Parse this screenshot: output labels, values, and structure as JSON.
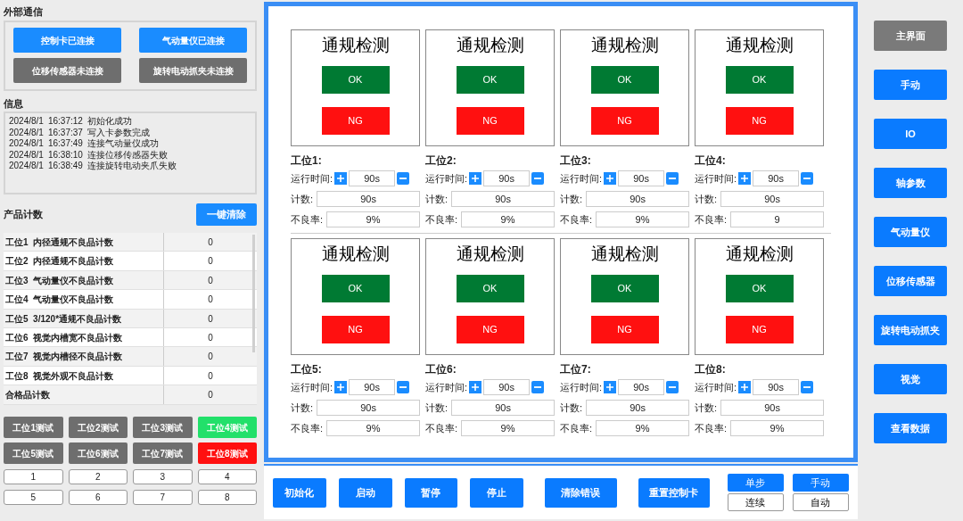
{
  "comm": {
    "title": "外部通信",
    "devices": [
      {
        "label": "控制卡已连接",
        "connected": true
      },
      {
        "label": "气动量仪已连接",
        "connected": true
      },
      {
        "label": "位移传感器未连接",
        "connected": false
      },
      {
        "label": "旋转电动抓夹未连接",
        "connected": false
      }
    ]
  },
  "info": {
    "title": "信息",
    "log": [
      {
        "date": "2024/8/1",
        "time": "16:37:12",
        "message": "初始化成功"
      },
      {
        "date": "2024/8/1",
        "time": "16:37:37",
        "message": "写入卡参数完成"
      },
      {
        "date": "2024/8/1",
        "time": "16:37:49",
        "message": "连接气动量仪成功"
      },
      {
        "date": "2024/8/1",
        "time": "16:38:10",
        "message": "连接位移传感器失败"
      },
      {
        "date": "2024/8/1",
        "time": "16:38:49",
        "message": "连接旋转电动夹爪失败"
      }
    ]
  },
  "counts": {
    "title": "产品计数",
    "clear_button": "一键清除",
    "rows": [
      {
        "label": "工位1  内径通规不良品计数",
        "value": "0"
      },
      {
        "label": "工位2  内径通规不良品计数",
        "value": "0"
      },
      {
        "label": "工位3  气动量仪不良品计数",
        "value": "0"
      },
      {
        "label": "工位4  气动量仪不良品计数",
        "value": "0"
      },
      {
        "label": "工位5  3/120*通规不良品计数",
        "value": "0"
      },
      {
        "label": "工位6  视觉内槽宽不良品计数",
        "value": "0"
      },
      {
        "label": "工位7  视觉内槽径不良品计数",
        "value": "0"
      },
      {
        "label": "工位8  视觉外观不良品计数",
        "value": "0"
      },
      {
        "label": "合格品计数",
        "value": "0"
      }
    ]
  },
  "test_buttons": [
    {
      "label": "工位1测试",
      "passed": false,
      "failed": false
    },
    {
      "label": "工位2测试",
      "passed": false,
      "failed": false
    },
    {
      "label": "工位3测试",
      "passed": false,
      "failed": false
    },
    {
      "label": "工位4测试",
      "passed": true,
      "failed": false
    },
    {
      "label": "工位5测试",
      "passed": false,
      "failed": false
    },
    {
      "label": "工位6测试",
      "passed": false,
      "failed": false
    },
    {
      "label": "工位7测试",
      "passed": false,
      "failed": false
    },
    {
      "label": "工位8测试",
      "passed": false,
      "failed": true
    }
  ],
  "number_buttons": [
    "1",
    "2",
    "3",
    "4",
    "5",
    "6",
    "7",
    "8"
  ],
  "stations": [
    {
      "title": "通规检测",
      "ok": "OK",
      "ng": "NG",
      "name": "工位1:",
      "runtime_label": "运行时间:",
      "runtime": "90s",
      "count_label": "计数:",
      "count": "90s",
      "reject_label": "不良率:",
      "reject": "9%"
    },
    {
      "title": "通规检测",
      "ok": "OK",
      "ng": "NG",
      "name": "工位2:",
      "runtime_label": "运行时间:",
      "runtime": "90s",
      "count_label": "计数:",
      "count": "90s",
      "reject_label": "不良率:",
      "reject": "9%"
    },
    {
      "title": "通规检测",
      "ok": "OK",
      "ng": "NG",
      "name": "工位3:",
      "runtime_label": "运行时间:",
      "runtime": "90s",
      "count_label": "计数:",
      "count": "90s",
      "reject_label": "不良率:",
      "reject": "9%"
    },
    {
      "title": "通规检测",
      "ok": "OK",
      "ng": "NG",
      "name": "工位4:",
      "runtime_label": "运行时间:",
      "runtime": "90s",
      "count_label": "计数:",
      "count": "90s",
      "reject_label": "不良率:",
      "reject": "9"
    },
    {
      "title": "通规检测",
      "ok": "OK",
      "ng": "NG",
      "name": "工位5:",
      "runtime_label": "运行时间:",
      "runtime": "90s",
      "count_label": "计数:",
      "count": "90s",
      "reject_label": "不良率:",
      "reject": "9%"
    },
    {
      "title": "通规检测",
      "ok": "OK",
      "ng": "NG",
      "name": "工位6:",
      "runtime_label": "运行时间:",
      "runtime": "90s",
      "count_label": "计数:",
      "count": "90s",
      "reject_label": "不良率:",
      "reject": "9%"
    },
    {
      "title": "通规检测",
      "ok": "OK",
      "ng": "NG",
      "name": "工位7:",
      "runtime_label": "运行时间:",
      "runtime": "90s",
      "count_label": "计数:",
      "count": "90s",
      "reject_label": "不良率:",
      "reject": "9%"
    },
    {
      "title": "通规检测",
      "ok": "OK",
      "ng": "NG",
      "name": "工位8:",
      "runtime_label": "运行时间:",
      "runtime": "90s",
      "count_label": "计数:",
      "count": "90s",
      "reject_label": "不良率:",
      "reject": "9%"
    }
  ],
  "controls": [
    "初始化",
    "启动",
    "暂停",
    "停止",
    "清除错误",
    "重置控制卡"
  ],
  "modes": [
    [
      {
        "label": "单步",
        "selected": true
      },
      {
        "label": "连续",
        "selected": false
      }
    ],
    [
      {
        "label": "手动",
        "selected": true
      },
      {
        "label": "自动",
        "selected": false
      }
    ]
  ],
  "nav": [
    {
      "label": "主界面",
      "selected": true
    },
    {
      "label": "手动",
      "selected": false
    },
    {
      "label": "IO",
      "selected": false
    },
    {
      "label": "轴参数",
      "selected": false
    },
    {
      "label": "气动量仪",
      "selected": false
    },
    {
      "label": "位移传感器",
      "selected": false
    },
    {
      "label": "旋转电动抓夹",
      "selected": false
    },
    {
      "label": "视觉",
      "selected": false
    },
    {
      "label": "查看数据",
      "selected": false
    }
  ]
}
